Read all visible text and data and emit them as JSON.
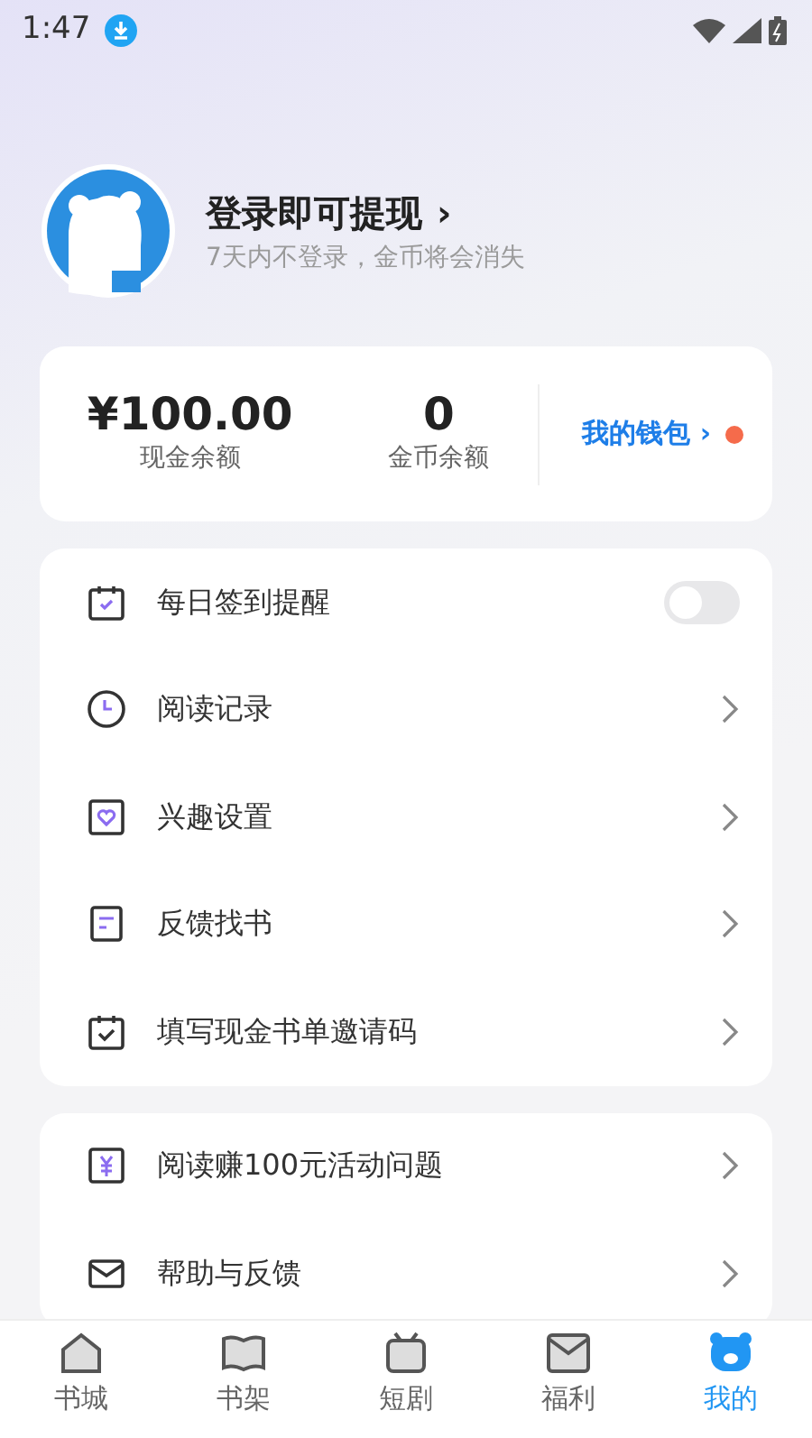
{
  "status_bar": {
    "time": "1:47"
  },
  "profile": {
    "title": "登录即可提现",
    "chevron": "›",
    "subtitle": "7天内不登录，金币将会消失"
  },
  "wallet": {
    "stats": [
      {
        "value": "¥100.00",
        "label": "现金余额"
      },
      {
        "value": "0",
        "label": "金币余额"
      }
    ],
    "link": {
      "label": "我的钱包",
      "chevron": "›",
      "dot": true
    }
  },
  "menu_groups": [
    {
      "items": [
        {
          "kind": "toggle",
          "label": "每日签到提醒",
          "on": false
        },
        {
          "kind": "link",
          "label": "阅读记录"
        },
        {
          "kind": "link",
          "label": "兴趣设置"
        },
        {
          "kind": "link",
          "label": "反馈找书"
        },
        {
          "kind": "link",
          "label": "填写现金书单邀请码"
        }
      ]
    },
    {
      "items": [
        {
          "kind": "link",
          "label": "阅读赚100元活动问题"
        },
        {
          "kind": "link",
          "label": "帮助与反馈"
        }
      ]
    }
  ],
  "tab_bar": [
    {
      "label": "书城",
      "selected": false
    },
    {
      "label": "书架",
      "selected": false
    },
    {
      "label": "短剧",
      "selected": false
    },
    {
      "label": "福利",
      "selected": false
    },
    {
      "label": "我的",
      "selected": true
    }
  ]
}
